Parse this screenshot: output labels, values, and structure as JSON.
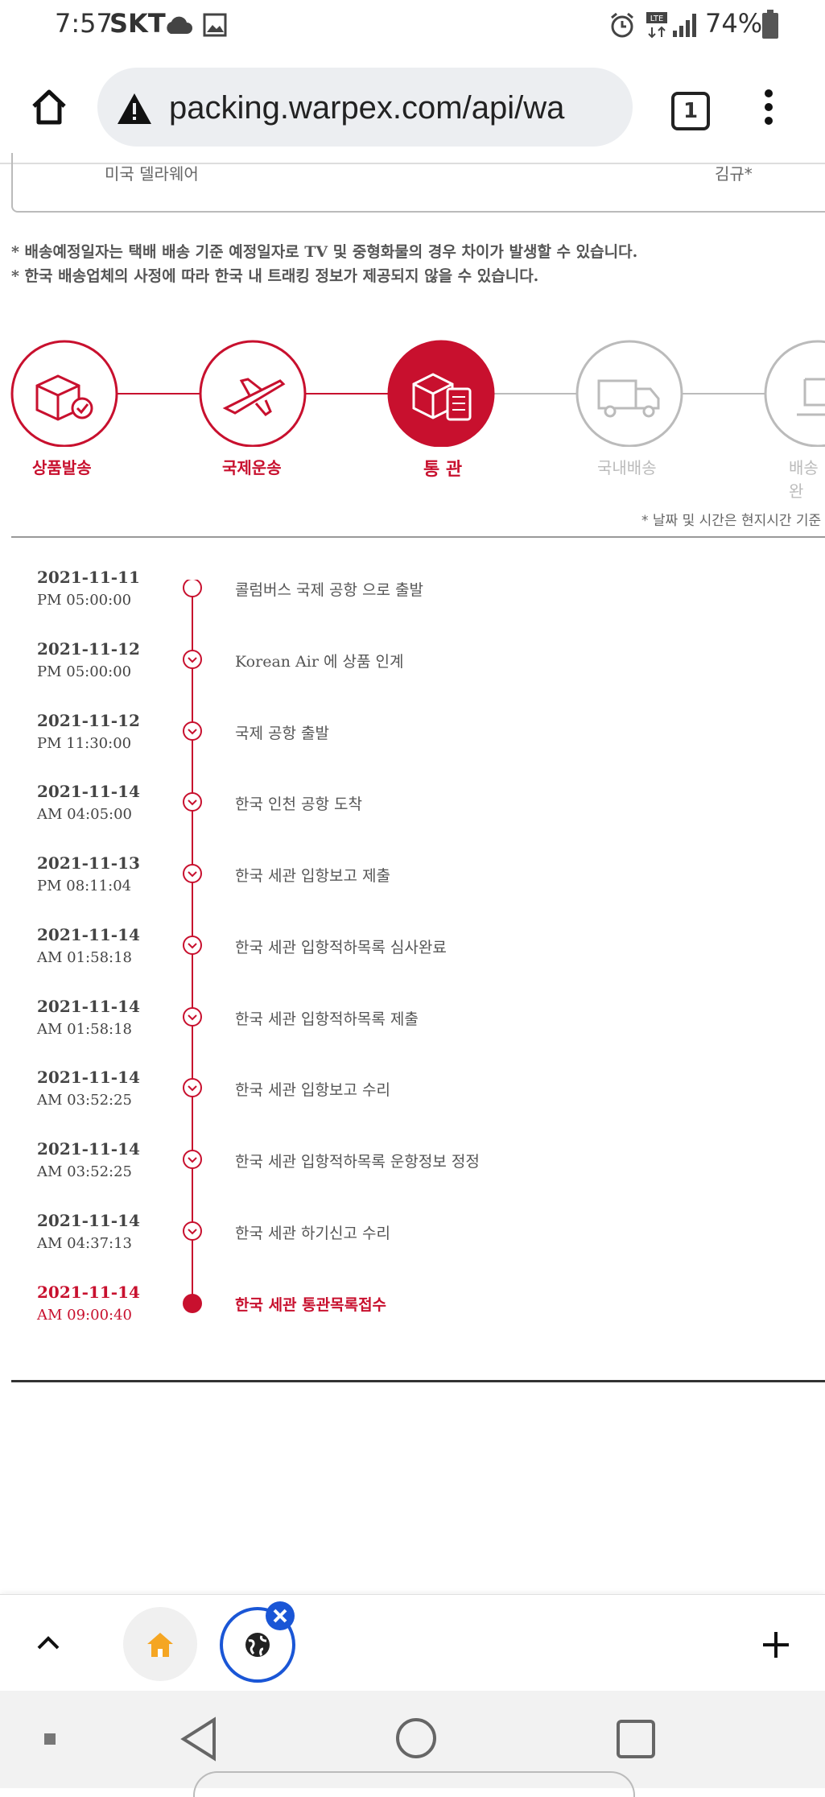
{
  "status_bar": {
    "time": "7:57",
    "carrier": "SKT",
    "battery_percent": "74%"
  },
  "browser": {
    "url": "packing.warpex.com/api/wa",
    "tab_count": "1"
  },
  "card": {
    "left_text": "미국 델라웨어",
    "right_text": "김규*"
  },
  "notices": [
    "* 배송예정일자는 택배 배송 기준 예정일자로 TV 및 중형화물의 경우 차이가 발생할 수 있습니다.",
    "* 한국 배송업체의 사정에 따라 한국 내 트래킹 정보가 제공되지 않을 수 있습니다."
  ],
  "steps": [
    {
      "label": "상품발송",
      "state": "done"
    },
    {
      "label": "국제운송",
      "state": "done"
    },
    {
      "label": "통 관",
      "state": "current"
    },
    {
      "label": "국내배송",
      "state": "pending"
    },
    {
      "label": "배송완",
      "state": "pending"
    }
  ],
  "timezone_note": "* 날짜 및 시간은 현지시간 기준",
  "events": [
    {
      "date": "2021-11-11",
      "time": "PM 05:00:00",
      "desc": "콜럼버스 국제 공항 으로 출발"
    },
    {
      "date": "2021-11-12",
      "time": "PM 05:00:00",
      "desc": "Korean Air 에 상품 인계"
    },
    {
      "date": "2021-11-12",
      "time": "PM 11:30:00",
      "desc": "국제 공항 출발"
    },
    {
      "date": "2021-11-14",
      "time": "AM 04:05:00",
      "desc": "한국 인천 공항 도착"
    },
    {
      "date": "2021-11-13",
      "time": "PM 08:11:04",
      "desc": "한국 세관 입항보고 제출"
    },
    {
      "date": "2021-11-14",
      "time": "AM 01:58:18",
      "desc": "한국 세관 입항적하목록 심사완료"
    },
    {
      "date": "2021-11-14",
      "time": "AM 01:58:18",
      "desc": "한국 세관 입항적하목록 제출"
    },
    {
      "date": "2021-11-14",
      "time": "AM 03:52:25",
      "desc": "한국 세관 입항보고 수리"
    },
    {
      "date": "2021-11-14",
      "time": "AM 03:52:25",
      "desc": "한국 세관 입항적하목록 운항정보 정정"
    },
    {
      "date": "2021-11-14",
      "time": "AM 04:37:13",
      "desc": "한국 세관 하기신고 수리"
    },
    {
      "date": "2021-11-14",
      "time": "AM 09:00:40",
      "desc": "한국 세관 통관목록접수"
    }
  ],
  "colors": {
    "accent": "#c8102e",
    "pending": "#bbbbbb",
    "text": "#444444"
  }
}
